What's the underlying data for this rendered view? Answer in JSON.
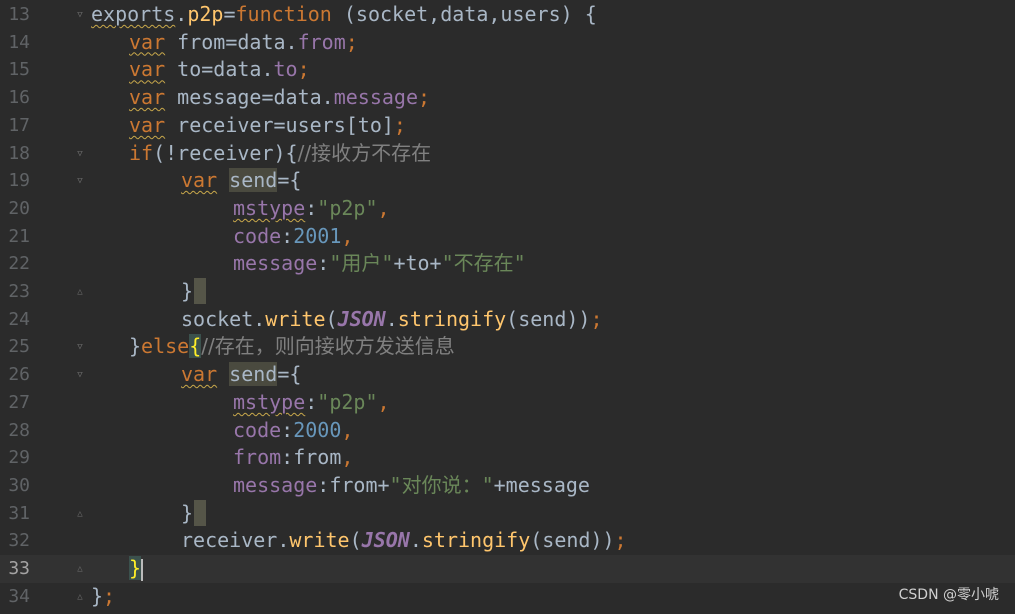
{
  "editor": {
    "lines": [
      {
        "no": "13",
        "code": "exports.p2p=function (socket,data,users) {"
      },
      {
        "no": "14",
        "code": "var from=data.from;"
      },
      {
        "no": "15",
        "code": "var to=data.to;"
      },
      {
        "no": "16",
        "code": "var message=data.message;"
      },
      {
        "no": "17",
        "code": "var receiver=users[to];"
      },
      {
        "no": "18",
        "code": "if(!receiver){//接收方不存在"
      },
      {
        "no": "19",
        "code": "var send={"
      },
      {
        "no": "20",
        "code": "mstype:\"p2p\","
      },
      {
        "no": "21",
        "code": "code:2001,"
      },
      {
        "no": "22",
        "code": "message:\"用户\"+to+\"不存在\""
      },
      {
        "no": "23",
        "code": "}"
      },
      {
        "no": "24",
        "code": "socket.write(JSON.stringify(send));"
      },
      {
        "no": "25",
        "code": "}else{//存在，则向接收方发送信息"
      },
      {
        "no": "26",
        "code": "var send={"
      },
      {
        "no": "27",
        "code": "mstype:\"p2p\","
      },
      {
        "no": "28",
        "code": "code:2000,"
      },
      {
        "no": "29",
        "code": "from:from,"
      },
      {
        "no": "30",
        "code": "message:from+\"对你说：\"+message"
      },
      {
        "no": "31",
        "code": "}"
      },
      {
        "no": "32",
        "code": "receiver.write(JSON.stringify(send));"
      },
      {
        "no": "33",
        "code": "}"
      },
      {
        "no": "34",
        "code": "};"
      }
    ],
    "current_line": "33"
  },
  "watermark": "CSDN @零小唬",
  "colors": {
    "background": "#2b2b2b",
    "keyword": "#cc7832",
    "string": "#6a8759",
    "number": "#6897bb",
    "function": "#ffc66d",
    "property": "#9876aa",
    "comment": "#808080",
    "identifier": "#a9b7c6"
  }
}
